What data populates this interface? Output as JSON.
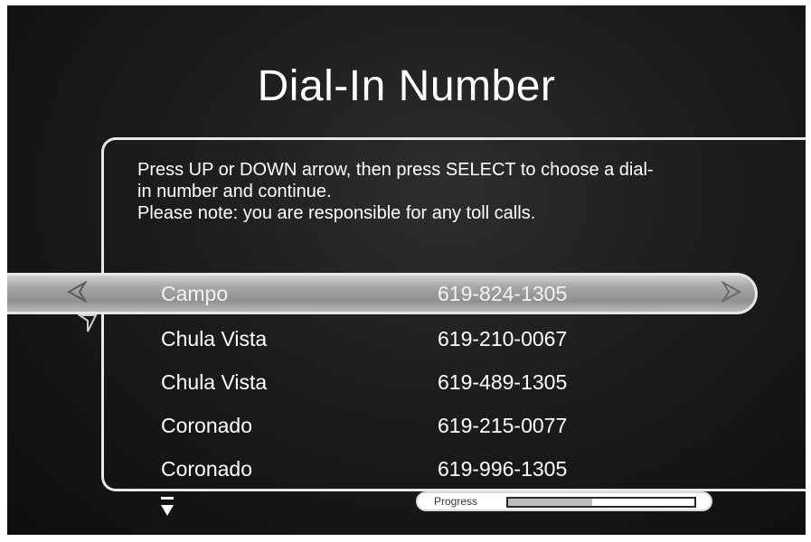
{
  "title": "Dial-In Number",
  "instructions": {
    "line1": "Press UP or DOWN arrow, then press SELECT to choose a dial-",
    "line2": "in number and continue.",
    "line3": "Please note: you are responsible for any toll calls."
  },
  "numbers": [
    {
      "city": "Campo",
      "number": "619-824-1305",
      "selected": true
    },
    {
      "city": "Chula Vista",
      "number": "619-210-0067",
      "selected": false
    },
    {
      "city": "Chula Vista",
      "number": "619-489-1305",
      "selected": false
    },
    {
      "city": "Coronado",
      "number": "619-215-0077",
      "selected": false
    },
    {
      "city": "Coronado",
      "number": "619-996-1305",
      "selected": false
    }
  ],
  "progress": {
    "label": "Progress",
    "value": 0.45
  },
  "icons": {
    "left": "left-arrow-icon",
    "right": "right-arrow-icon",
    "up": "up-arrow-icon",
    "down": "down-arrow-icon"
  }
}
